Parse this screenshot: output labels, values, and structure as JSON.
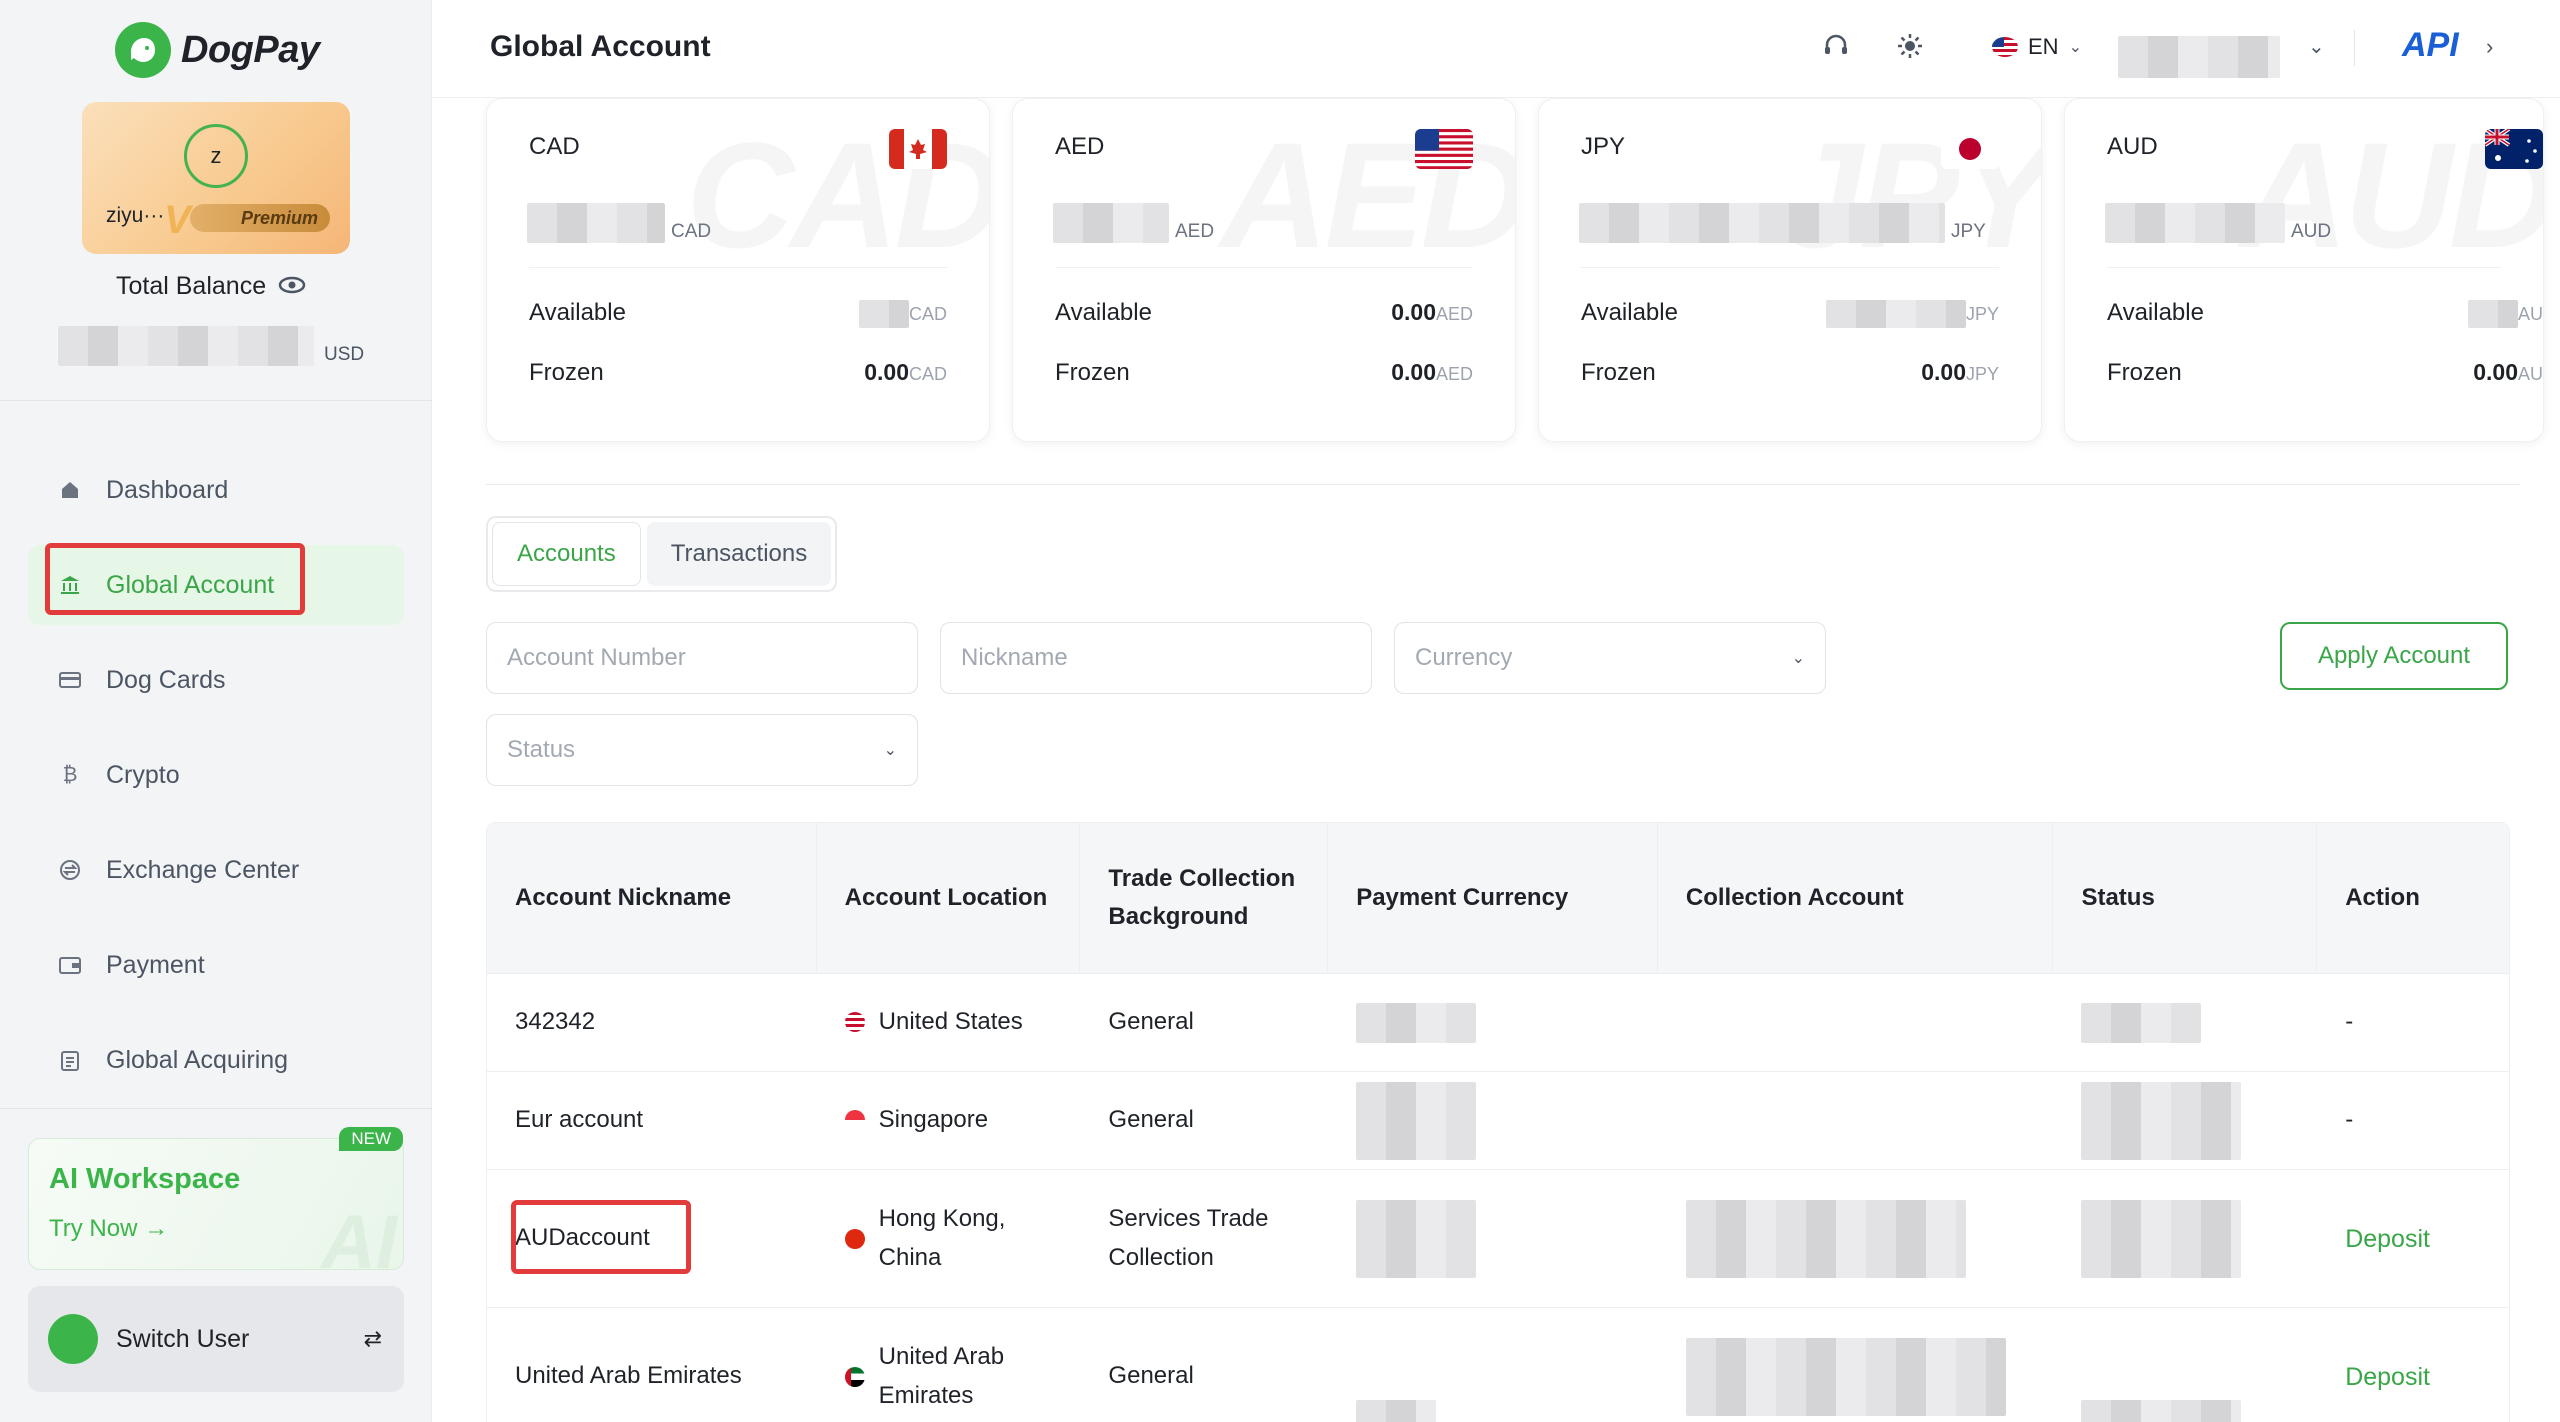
{
  "app": {
    "brand": "DogPay"
  },
  "user": {
    "initial": "z",
    "name": "ziyu···",
    "tier": "Premium",
    "tier_mark": "V"
  },
  "balance": {
    "label": "Total Balance",
    "unit": "USD"
  },
  "nav": [
    {
      "label": "Dashboard",
      "icon": "house-icon"
    },
    {
      "label": "Global Account",
      "icon": "bank-icon",
      "active": true
    },
    {
      "label": "Dog Cards",
      "icon": "card-icon"
    },
    {
      "label": "Crypto",
      "icon": "bitcoin-icon"
    },
    {
      "label": "Exchange Center",
      "icon": "exchange-icon"
    },
    {
      "label": "Payment",
      "icon": "wallet-icon"
    },
    {
      "label": "Global Acquiring",
      "icon": "clipboard-icon"
    }
  ],
  "ai_workspace": {
    "badge": "NEW",
    "title": "AI Workspace",
    "cta": "Try Now →",
    "watermark": "AI"
  },
  "switch_user": {
    "label": "Switch User"
  },
  "header": {
    "title": "Global Account",
    "lang": "EN",
    "api": "API"
  },
  "cards": [
    {
      "code": "CAD",
      "unit": "CAD",
      "available_label": "Available",
      "available_unit": "CAD",
      "frozen_label": "Frozen",
      "frozen_value": "0.00",
      "frozen_unit": "CAD"
    },
    {
      "code": "AED",
      "unit": "AED",
      "available_label": "Available",
      "available_value": "0.00",
      "available_unit": "AED",
      "frozen_label": "Frozen",
      "frozen_value": "0.00",
      "frozen_unit": "AED"
    },
    {
      "code": "JPY",
      "unit": "JPY",
      "available_label": "Available",
      "available_unit": "JPY",
      "frozen_label": "Frozen",
      "frozen_value": "0.00",
      "frozen_unit": "JPY"
    },
    {
      "code": "AUD",
      "unit": "AUD",
      "available_label": "Available",
      "available_unit": "AU",
      "frozen_label": "Frozen",
      "frozen_value": "0.00",
      "frozen_unit": "AU"
    }
  ],
  "tabs": [
    {
      "label": "Accounts",
      "active": true
    },
    {
      "label": "Transactions"
    }
  ],
  "filters": {
    "account_number": "Account Number",
    "nickname": "Nickname",
    "currency": "Currency",
    "status": "Status",
    "apply": "Apply Account"
  },
  "table": {
    "headers": [
      "Account Nickname",
      "Account Location",
      "Trade Collection Background",
      "Payment Currency",
      "Collection Account",
      "Status",
      "Action"
    ],
    "rows": [
      {
        "nickname": "342342",
        "location": "United States",
        "background": "General",
        "action": "-"
      },
      {
        "nickname": "Eur account",
        "location": "Singapore",
        "background": "General",
        "action": "-"
      },
      {
        "nickname": "AUDaccount",
        "location": "Hong Kong, China",
        "background": "Services Trade Collection",
        "action": "Deposit"
      },
      {
        "nickname": "United Arab Emirates",
        "location": "United Arab Emirates",
        "background": "General",
        "action": "Deposit"
      }
    ]
  },
  "colors": {
    "accent": "#3aa648",
    "highlight": "#e23b3b",
    "api": "#1a5fd8"
  }
}
